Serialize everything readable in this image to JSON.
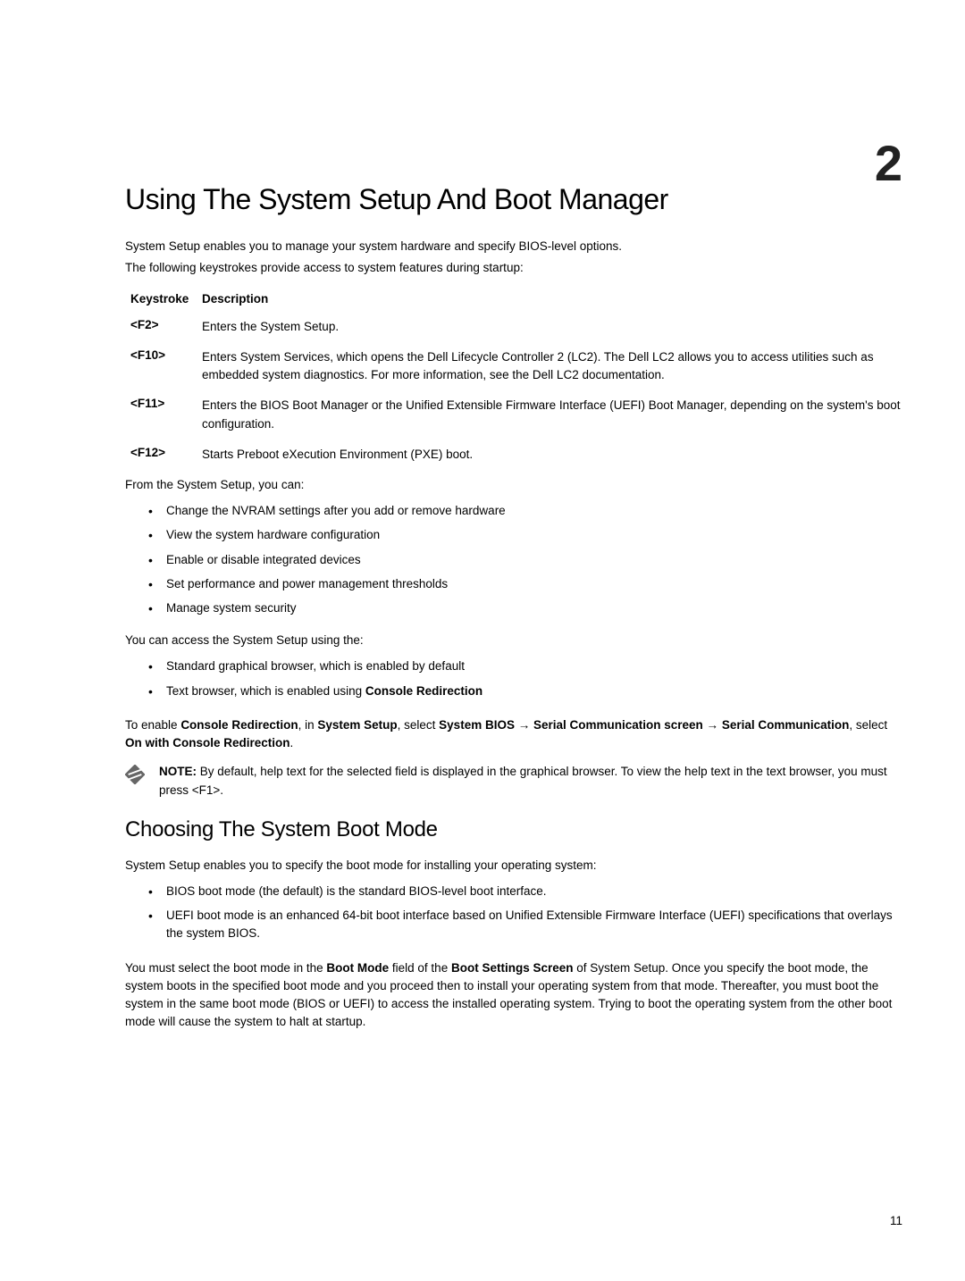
{
  "chapter": {
    "number": "2",
    "title": "Using The System Setup And Boot Manager"
  },
  "intro": {
    "line1": "System Setup enables you to manage your system hardware and specify BIOS-level options.",
    "line2": "The following keystrokes provide access to system features during startup:"
  },
  "table": {
    "header_col1": "Keystroke",
    "header_col2": "Description",
    "rows": [
      {
        "key": "<F2>",
        "desc": "Enters the System Setup."
      },
      {
        "key": "<F10>",
        "desc": "Enters System Services, which opens the Dell Lifecycle Controller 2 (LC2). The Dell LC2 allows you to access utilities such as embedded system diagnostics. For more information, see the Dell LC2 documentation."
      },
      {
        "key": "<F11>",
        "desc": "Enters the BIOS Boot Manager or the Unified Extensible Firmware Interface (UEFI) Boot Manager, depending on the system's boot configuration."
      },
      {
        "key": "<F12>",
        "desc": "Starts Preboot eXecution Environment (PXE) boot."
      }
    ]
  },
  "list1": {
    "intro": "From the System Setup, you can:",
    "items": [
      "Change the NVRAM settings after you add or remove hardware",
      "View the system hardware configuration",
      "Enable or disable integrated devices",
      "Set performance and power management thresholds",
      "Manage system security"
    ]
  },
  "list2": {
    "intro": "You can access the System Setup using the:",
    "items": [
      "Standard graphical browser, which is enabled by default"
    ],
    "item2_prefix": "Text browser, which is enabled using ",
    "item2_bold": "Console Redirection"
  },
  "enable": {
    "pre1": "To enable ",
    "b1": "Console Redirection",
    "mid1": ", in ",
    "b2": "System Setup",
    "mid2": ", select ",
    "b3": "System BIOS",
    "arrow1": " → ",
    "b4": "Serial Communication screen",
    "arrow2": " → ",
    "b5": "Serial Communication",
    "mid3": ", select ",
    "b6": "On with Console Redirection",
    "end": "."
  },
  "note": {
    "label": "NOTE:",
    "text": " By default, help text for the selected field is displayed in the graphical browser. To view the help text in the text browser, you must press <F1>."
  },
  "section": {
    "title": "Choosing The System Boot Mode",
    "intro": "System Setup enables you to specify the boot mode for installing your operating system:",
    "items": [
      "BIOS boot mode (the default) is the standard BIOS-level boot interface.",
      "UEFI boot mode is an enhanced 64-bit boot interface based on Unified Extensible Firmware Interface (UEFI) specifications that overlays the system BIOS."
    ],
    "para_pre": "You must select the boot mode in the ",
    "para_b1": "Boot Mode",
    "para_mid1": " field of the ",
    "para_b2": "Boot Settings Screen",
    "para_post": " of System Setup. Once you specify the boot mode, the system boots in the specified boot mode and you proceed then to install your operating system from that mode. Thereafter, you must boot the system in the same boot mode (BIOS or UEFI) to access the installed operating system. Trying to boot the operating system from the other boot mode will cause the system to halt at startup."
  },
  "page_number": "11"
}
